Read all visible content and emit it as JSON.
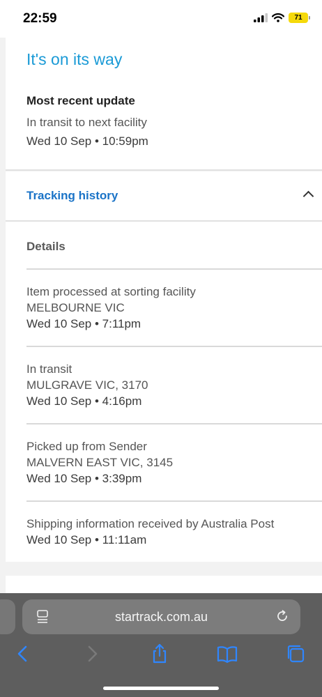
{
  "status_bar": {
    "time": "22:59",
    "battery_level": "71"
  },
  "shipment": {
    "headline": "It's on its way",
    "recent_label": "Most recent update",
    "recent_status": "In transit to next facility",
    "recent_time": "Wed 10 Sep • 10:59pm"
  },
  "tracking": {
    "title": "Tracking history",
    "details_label": "Details",
    "events": [
      {
        "description": "Item processed at sorting facility",
        "location": "MELBOURNE VIC",
        "time": "Wed 10 Sep • 7:11pm"
      },
      {
        "description": "In transit",
        "location": "MULGRAVE VIC, 3170",
        "time": "Wed 10 Sep • 4:16pm"
      },
      {
        "description": "Picked up from Sender",
        "location": "MALVERN EAST VIC, 3145",
        "time": "Wed 10 Sep • 3:39pm"
      },
      {
        "description": "Shipping information received by Australia Post",
        "time": "Wed 10 Sep • 11:11am"
      }
    ]
  },
  "browser": {
    "url": "startrack.com.au"
  },
  "colors": {
    "headline": "#1a9ad6",
    "link": "#1a73c7",
    "toolbar_icons": "#2f86ff"
  }
}
